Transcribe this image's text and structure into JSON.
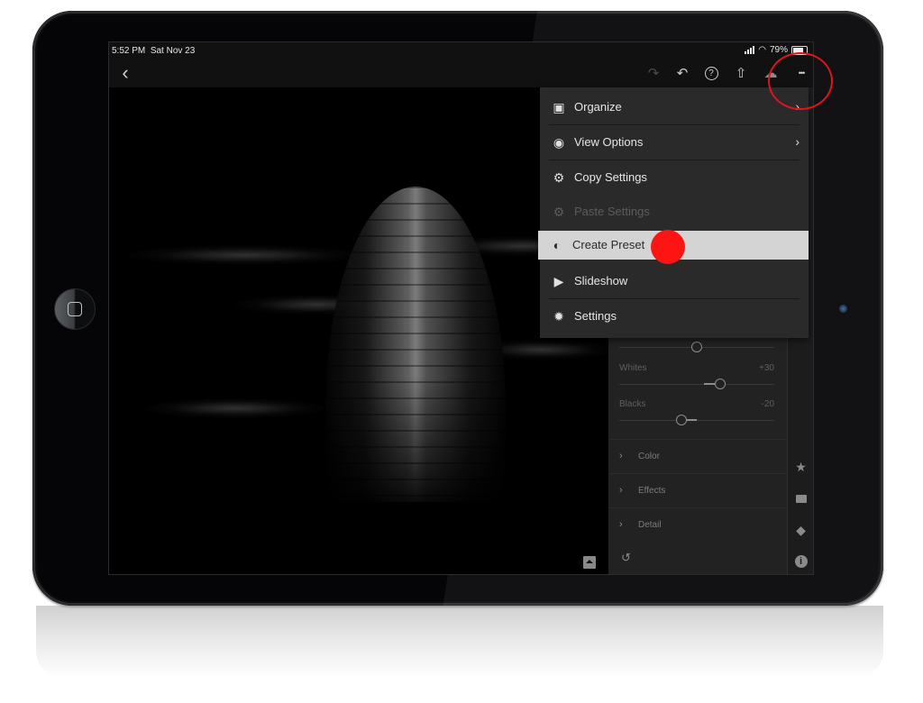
{
  "status_bar": {
    "time": "5:52 PM",
    "date": "Sat Nov 23",
    "battery_text": "79%",
    "battery_level": 0.79
  },
  "toolbar": {
    "back_icon": "chevron-left-icon",
    "redo_icon": "redo-icon",
    "undo_icon": "undo-icon",
    "help_icon": "help-circle-icon",
    "share_icon": "share-icon",
    "cloud_icon": "cloud-add-icon",
    "more_icon": "more-dots-icon"
  },
  "menu": {
    "items": [
      {
        "label": "Organize",
        "icon": "folder-icon",
        "has_submenu": true,
        "disabled": false,
        "highlighted": false
      },
      {
        "label": "View Options",
        "icon": "view-options-icon",
        "has_submenu": true,
        "disabled": false,
        "highlighted": false
      },
      {
        "label": "Copy Settings",
        "icon": "copy-settings-icon",
        "has_submenu": false,
        "disabled": false,
        "highlighted": false
      },
      {
        "label": "Paste Settings",
        "icon": "paste-settings-icon",
        "has_submenu": false,
        "disabled": true,
        "highlighted": false
      },
      {
        "label": "Create Preset",
        "icon": "create-preset-icon",
        "has_submenu": false,
        "disabled": false,
        "highlighted": true
      },
      {
        "label": "Slideshow",
        "icon": "play-icon",
        "has_submenu": false,
        "disabled": false,
        "highlighted": false
      },
      {
        "label": "Settings",
        "icon": "gear-icon",
        "has_submenu": false,
        "disabled": false,
        "highlighted": false
      }
    ]
  },
  "edit_panel": {
    "sliders": [
      {
        "label": "",
        "value": "",
        "position": 0.5
      },
      {
        "label": "Whites",
        "value": "+30",
        "position": 0.65
      },
      {
        "label": "Blacks",
        "value": "-20",
        "position": 0.4
      }
    ],
    "sections": [
      {
        "label": "Color"
      },
      {
        "label": "Effects"
      },
      {
        "label": "Detail"
      }
    ]
  },
  "side_rail": {
    "icons": [
      "star-icon",
      "comment-icon",
      "tag-icon",
      "info-icon"
    ]
  },
  "glyphs": {
    "back": "‹",
    "redo": "↷",
    "undo": "↶",
    "help": "?",
    "share": "⇧",
    "cloud": "☁",
    "more": "•••",
    "arrow": "›",
    "folder": "🗂",
    "view": "◉",
    "copy": "⚙",
    "paste": "⚙",
    "preset": "◐",
    "play": "▶",
    "gear": "✹",
    "chev": "›",
    "star": "★",
    "comment": "▀",
    "tag": "◆",
    "info": "i",
    "reset": "↺"
  },
  "annotations": {
    "tap_dot_color": "#ff1414",
    "callout_color": "#e0141e"
  }
}
